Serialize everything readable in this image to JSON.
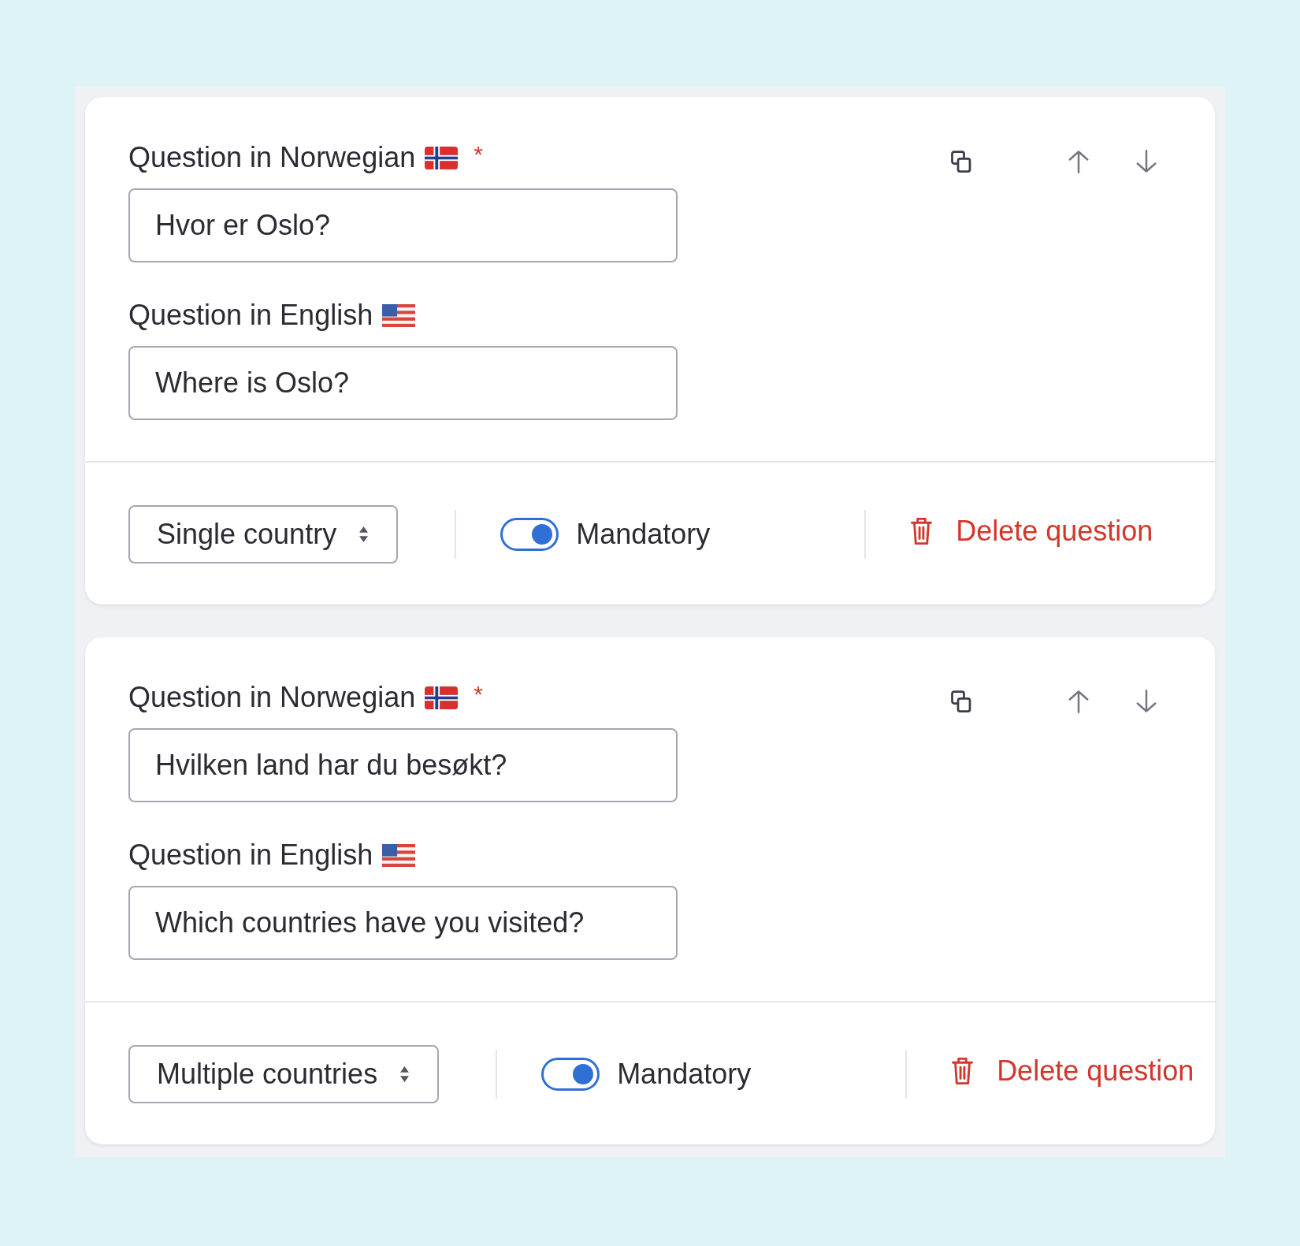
{
  "questions": [
    {
      "fields": [
        {
          "kind": "norwegian",
          "label": "Question in Norwegian",
          "required_mark": "*",
          "value": "Hvor er Oslo?"
        },
        {
          "kind": "english",
          "label": "Question in English",
          "value": "Where is Oslo?"
        }
      ],
      "answer_type": "Single country",
      "mandatory": {
        "label": "Mandatory",
        "on": true
      },
      "delete_label": "Delete question"
    },
    {
      "fields": [
        {
          "kind": "norwegian",
          "label": "Question in Norwegian",
          "required_mark": "*",
          "value": "Hvilken land har du besøkt?"
        },
        {
          "kind": "english",
          "label": "Question in English",
          "value": "Which countries have you visited?"
        }
      ],
      "answer_type": "Multiple countries",
      "mandatory": {
        "label": "Mandatory",
        "on": true
      },
      "delete_label": "Delete question"
    }
  ]
}
